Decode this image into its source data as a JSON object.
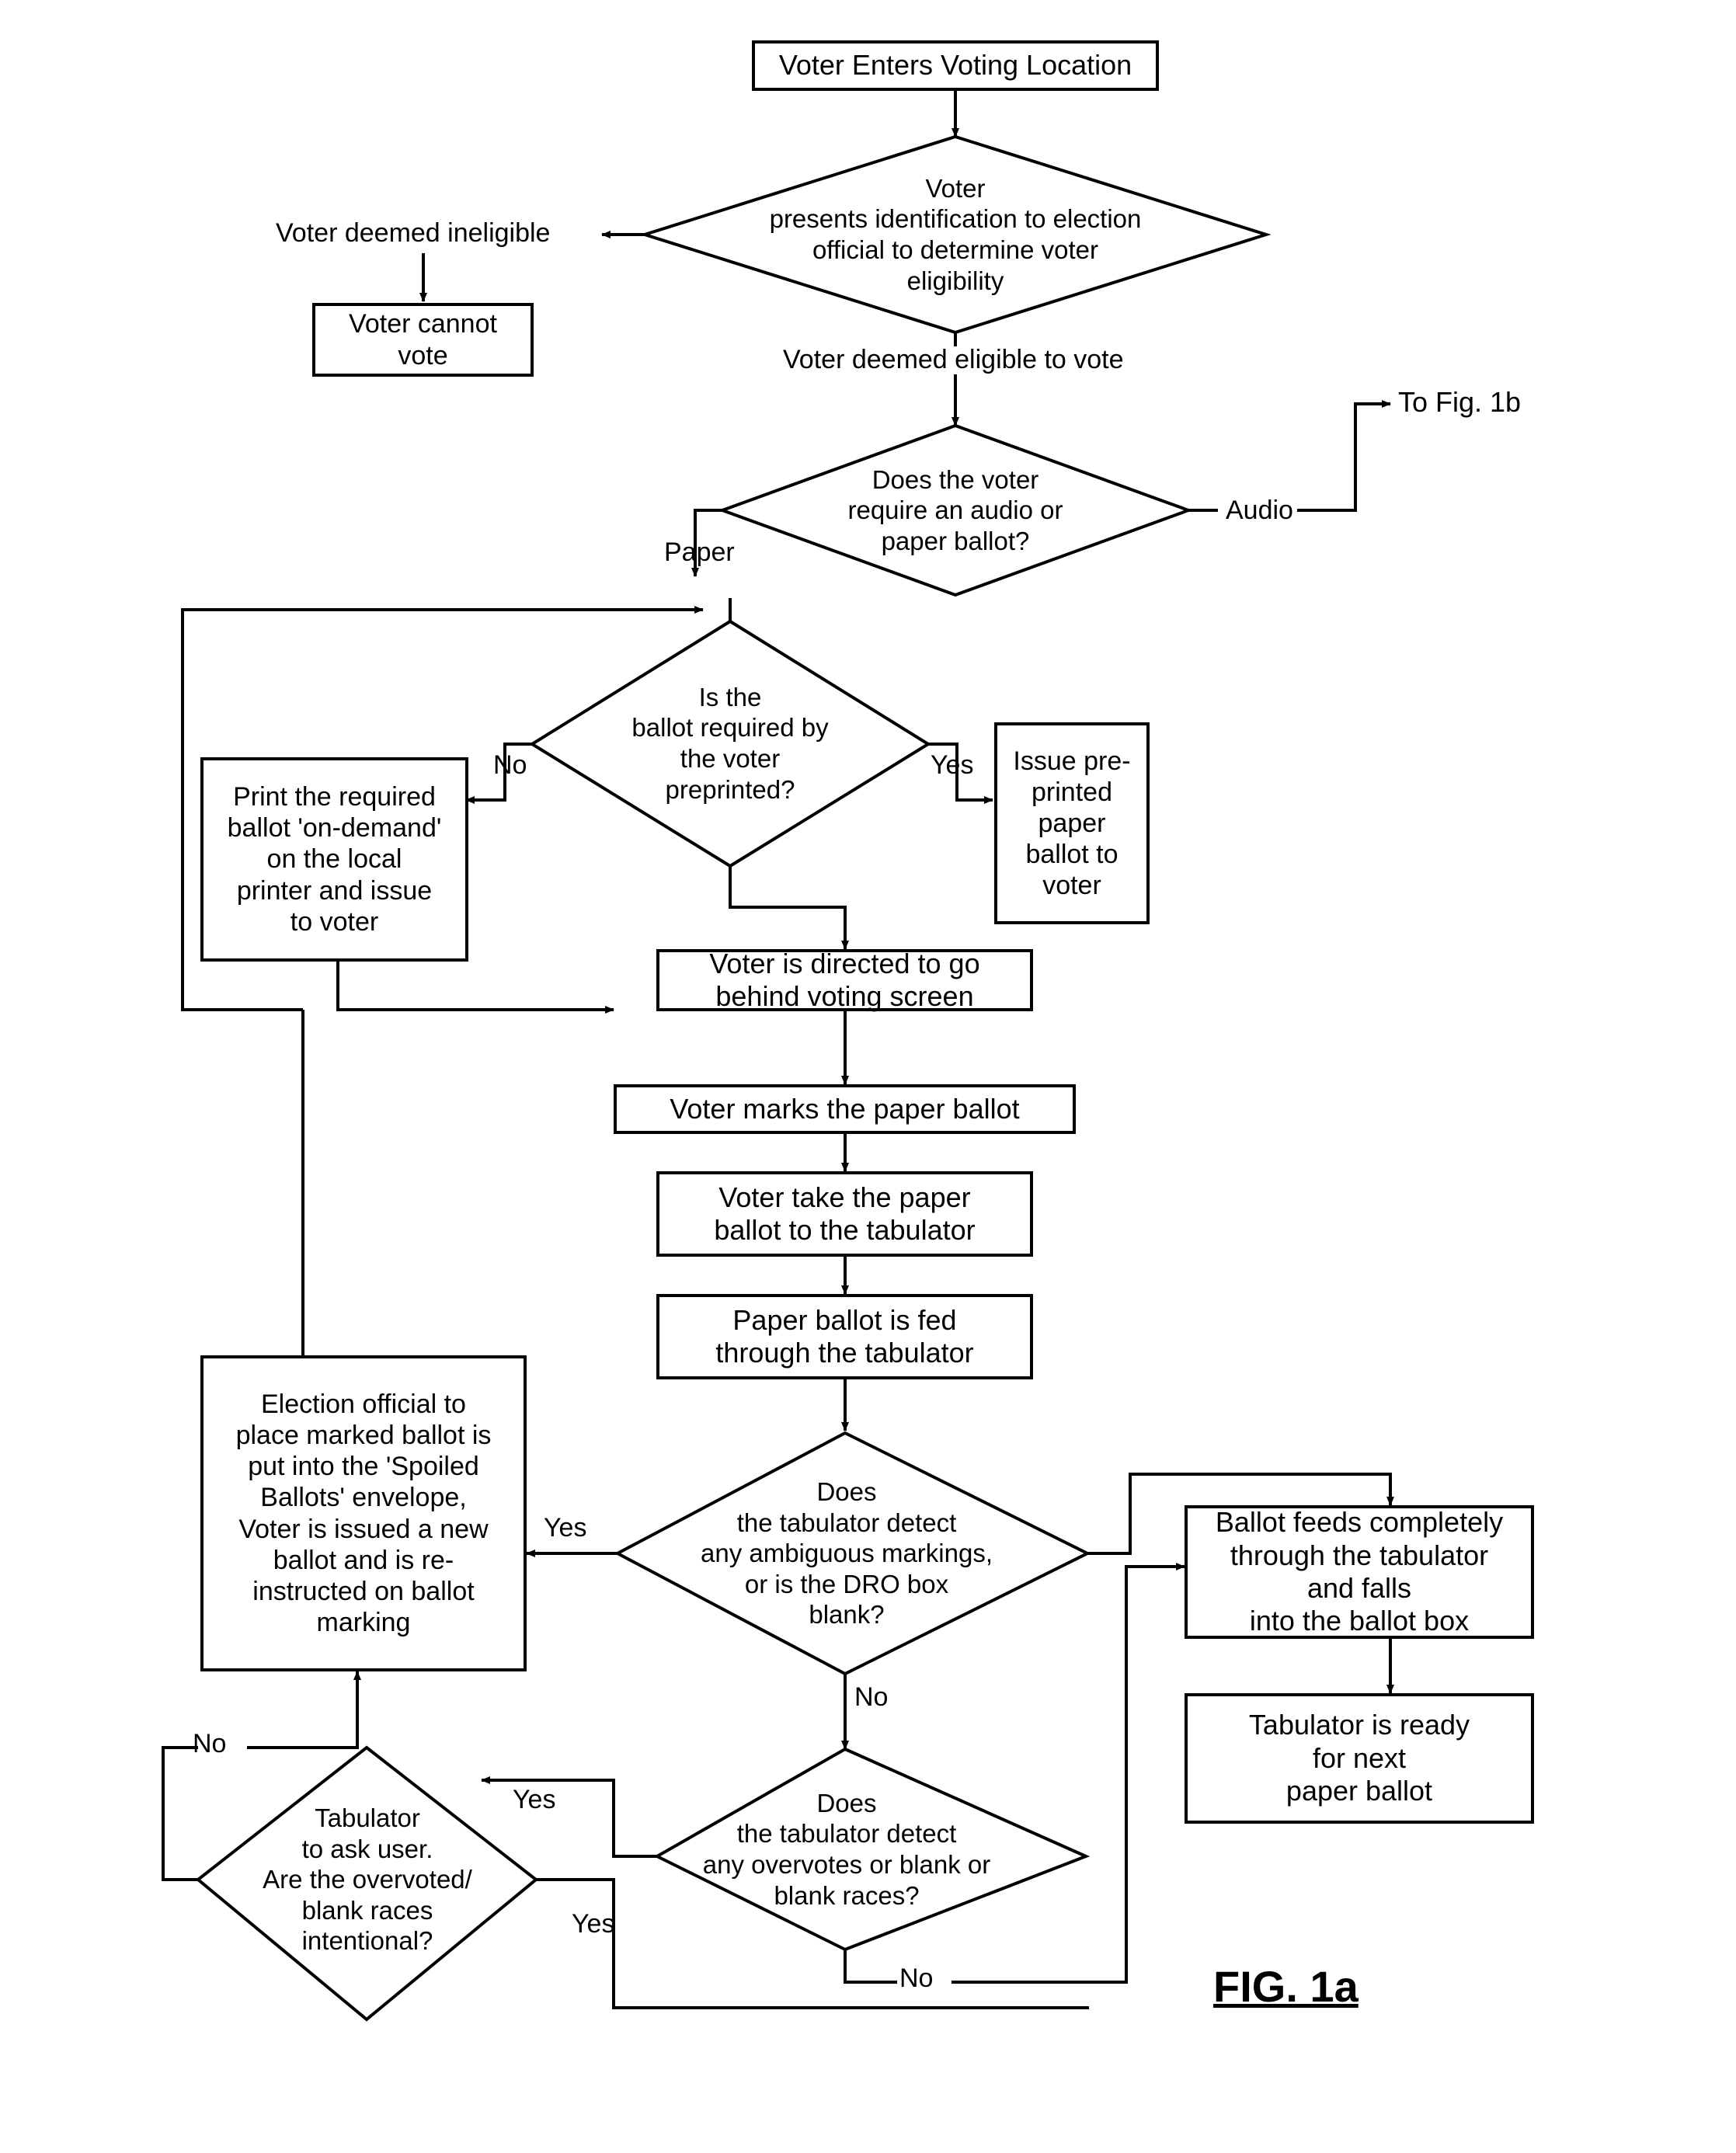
{
  "figure": {
    "label": "FIG. 1a",
    "title": "Voter Enters Voting Location"
  },
  "nodes": {
    "start": {
      "text": "Voter Enters Voting Location"
    },
    "identity_check": {
      "text": "Voter\npresents identification to election\nofficial to determine voter\neligibility"
    },
    "cannot_vote": {
      "text": "Voter cannot\nvote"
    },
    "ballot_type": {
      "text": "Does the voter\nrequire an audio or\npaper ballot?"
    },
    "preprinted_check": {
      "text": "Is the\nballot required by\nthe voter\npreprinted?"
    },
    "print_on_demand": {
      "text": "Print the required\nballot 'on-demand'\non the local\nprinter and issue\nto voter"
    },
    "issue_preprinted": {
      "text": "Issue pre-\nprinted\npaper\nballot to\nvoter"
    },
    "behind_screen": {
      "text": "Voter is directed to go\nbehind voting screen"
    },
    "marks_ballot": {
      "text": "Voter marks the paper ballot"
    },
    "take_to_tabulator": {
      "text": "Voter take the paper\nballot to the tabulator"
    },
    "fed_through": {
      "text": "Paper ballot is fed\nthrough the tabulator"
    },
    "ambiguous_check": {
      "text": "Does\nthe tabulator detect\nany ambiguous markings,\nor is the DRO box\nblank?"
    },
    "spoiled_ballot": {
      "text": "Election official to\nplace marked ballot is\nput into the 'Spoiled\nBallots' envelope,\nVoter is issued a new\nballot and is re-\ninstructed on ballot\nmarking"
    },
    "overvote_check": {
      "text": "Does\nthe tabulator detect\nany overvotes or blank or\nblank races?"
    },
    "ask_user": {
      "text": "Tabulator\nto ask user.\nAre the overvoted/\nblank races\nintentional?"
    },
    "feeds_completely": {
      "text": "Ballot feeds completely\nthrough the tabulator\nand falls\ninto the ballot box"
    },
    "ready_next": {
      "text": "Tabulator is ready\nfor next\npaper ballot"
    }
  },
  "free_text": {
    "ineligible": "Voter deemed ineligible",
    "eligible": "Voter deemed eligible to vote",
    "to_fig_1b": "To Fig. 1b"
  },
  "edge_labels": {
    "audio": "Audio",
    "paper": "Paper",
    "preprinted_no": "No",
    "preprinted_yes": "Yes",
    "ambiguous_yes": "Yes",
    "ambiguous_no": "No",
    "overvote_yes": "Yes",
    "overvote_no": "No",
    "ask_yes": "Yes",
    "ask_no": "No"
  },
  "colors": {
    "ink": "#000000",
    "paper": "#ffffff"
  }
}
